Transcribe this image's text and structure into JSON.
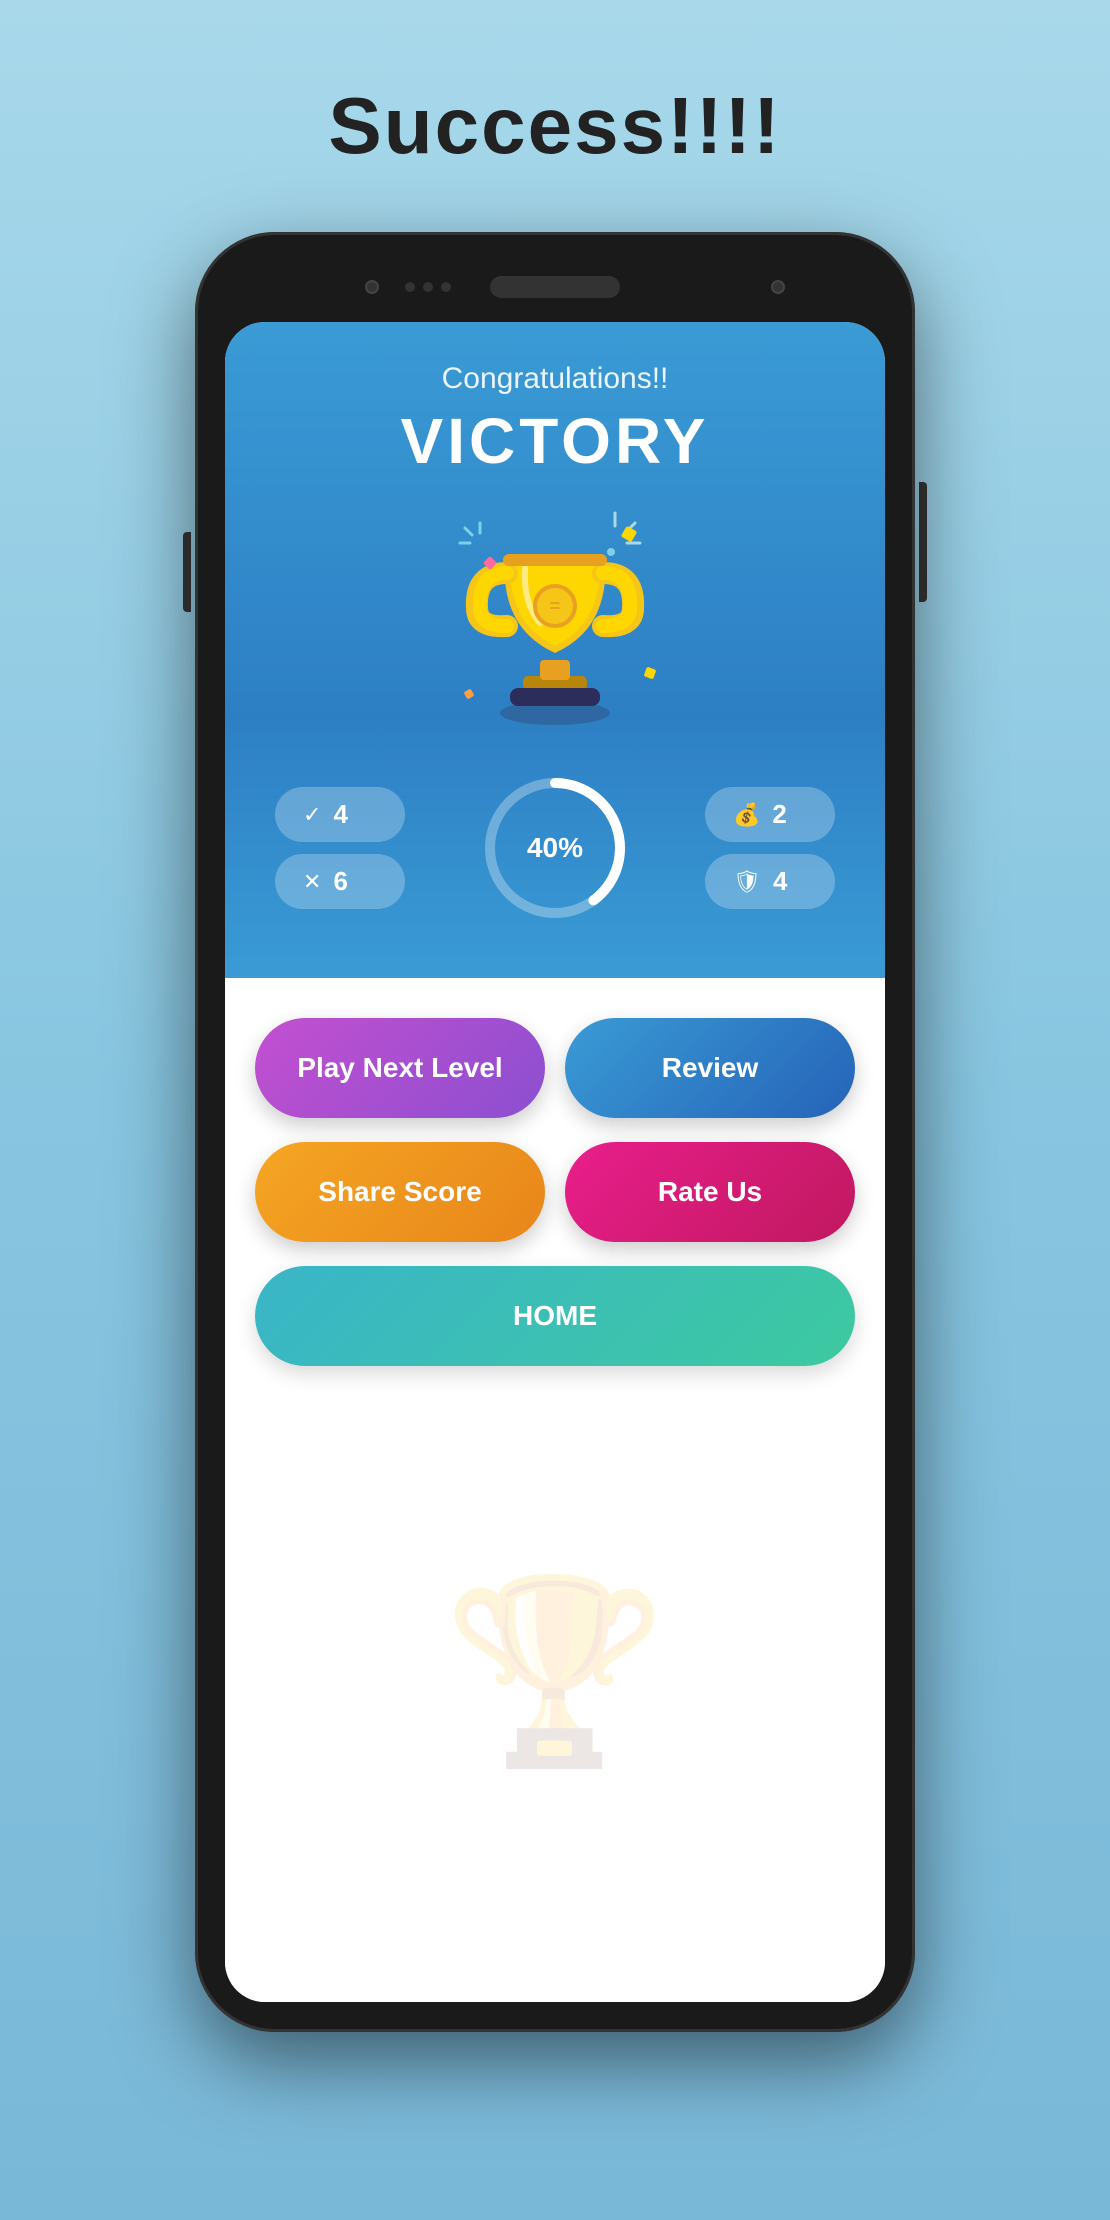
{
  "page": {
    "success_title": "Success!!!!",
    "background_color": "#a8d8ea"
  },
  "victory_card": {
    "congratulations": "Congratulations!!",
    "victory": "VICTORY",
    "progress_percent": "40%",
    "correct_count": "4",
    "wrong_count": "6",
    "coins": "2",
    "shields": "4"
  },
  "buttons": {
    "play_next_level": "Play Next Level",
    "review": "Review",
    "share_score": "Share Score",
    "rate_us": "Rate Us",
    "home": "HOME"
  }
}
